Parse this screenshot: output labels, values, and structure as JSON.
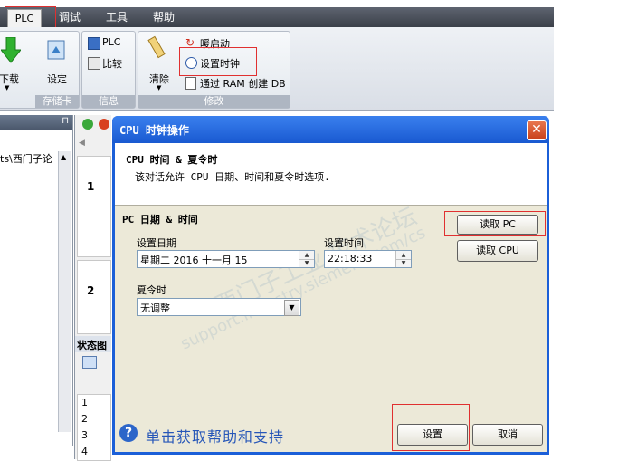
{
  "menu": {
    "tabs": [
      "PLC",
      "调试",
      "工具",
      "帮助"
    ]
  },
  "ribbon": {
    "download_label": "下载",
    "setup_label": "设定",
    "plc_label": "PLC",
    "compare_label": "比较",
    "clear_label": "清除",
    "warm_start_label": "暖启动",
    "set_clock_label": "设置时钟",
    "create_db_label": "通过 RAM 创建 DB",
    "group_memory_card": "存储卡",
    "group_info": "信息",
    "group_modify": "修改"
  },
  "left_pane": {
    "tree_item": "ts\\西门子论"
  },
  "side": {
    "row1": "1",
    "row2": "2",
    "status_title": "状态图",
    "rows": [
      "1",
      "2",
      "3",
      "4"
    ]
  },
  "dialog": {
    "title": "CPU 时钟操作",
    "header_title": "CPU 时间 & 夏令时",
    "header_desc": "该对话允许 CPU 日期、时间和夏令时选项.",
    "section_title": "PC 日期 & 时间",
    "date_label": "设置日期",
    "date_value": "星期二 2016 十一月 15",
    "time_label": "设置时间",
    "time_value": "22:18:33",
    "dst_label": "夏令时",
    "dst_value": "无调整",
    "read_pc_button": "读取 PC",
    "read_cpu_button": "读取 CPU",
    "help_text": "单击获取帮助和支持",
    "set_button": "设置",
    "cancel_button": "取消"
  },
  "watermark": {
    "line1": "西门子工业 技术论坛",
    "line2": "support.industry.siemens.com/cs"
  },
  "colors": {
    "title_bar": "#1959d1",
    "highlight_red": "#e03030",
    "dialog_bg": "#ece9d8"
  }
}
